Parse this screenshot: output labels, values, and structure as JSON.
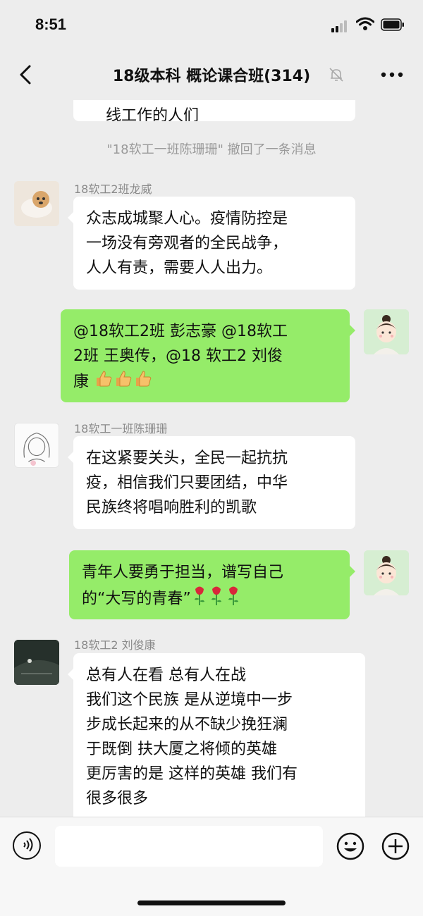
{
  "status_bar": {
    "time": "8:51"
  },
  "nav": {
    "title": "18级本科 概论课合班(314)"
  },
  "chat": {
    "cut_off_text": "线工作的人们",
    "system_message": "\"18软工一班陈珊珊\" 撤回了一条消息",
    "messages": [
      {
        "direction": "incoming",
        "sender": "18软工2班龙威",
        "avatar_icon": "dog-photo-avatar",
        "text": "众志成城聚人心。疫情防控是\n一场没有旁观者的全民战争，\n人人有责，需要人人出力。"
      },
      {
        "direction": "outgoing",
        "avatar_icon": "girl-cartoon-avatar",
        "text": "@18软工2班 彭志豪 @18软工\n2班 王奥传，@18 软工2 刘俊\n康",
        "emoji": [
          "thumbs-up-icon",
          "thumbs-up-icon",
          "thumbs-up-icon"
        ]
      },
      {
        "direction": "incoming",
        "sender": "18软工一班陈珊珊",
        "avatar_icon": "sketch-girl-avatar",
        "text": "在这紧要关头，全民一起抗抗\n疫，相信我们只要团结，中华\n民族终将唱响胜利的凯歌"
      },
      {
        "direction": "outgoing",
        "avatar_icon": "girl-cartoon-avatar",
        "text": "青年人要勇于担当，谱写自己\n的“大写的青春”",
        "emoji": [
          "rose-icon",
          "rose-icon",
          "rose-icon"
        ]
      },
      {
        "direction": "incoming",
        "sender": "18软工2 刘俊康",
        "avatar_icon": "dark-photo-avatar",
        "text": "总有人在看 总有人在战\n我们这个民族 是从逆境中一步\n步成长起来的从不缺少挽狂澜\n于既倒 扶大厦之将倾的英雄\n更厉害的是 这样的英雄 我们有\n很多很多"
      }
    ]
  },
  "input_bar": {
    "value": ""
  },
  "colors": {
    "background": "#ededed",
    "outgoing_bubble": "#95ec69",
    "incoming_bubble": "#ffffff"
  }
}
